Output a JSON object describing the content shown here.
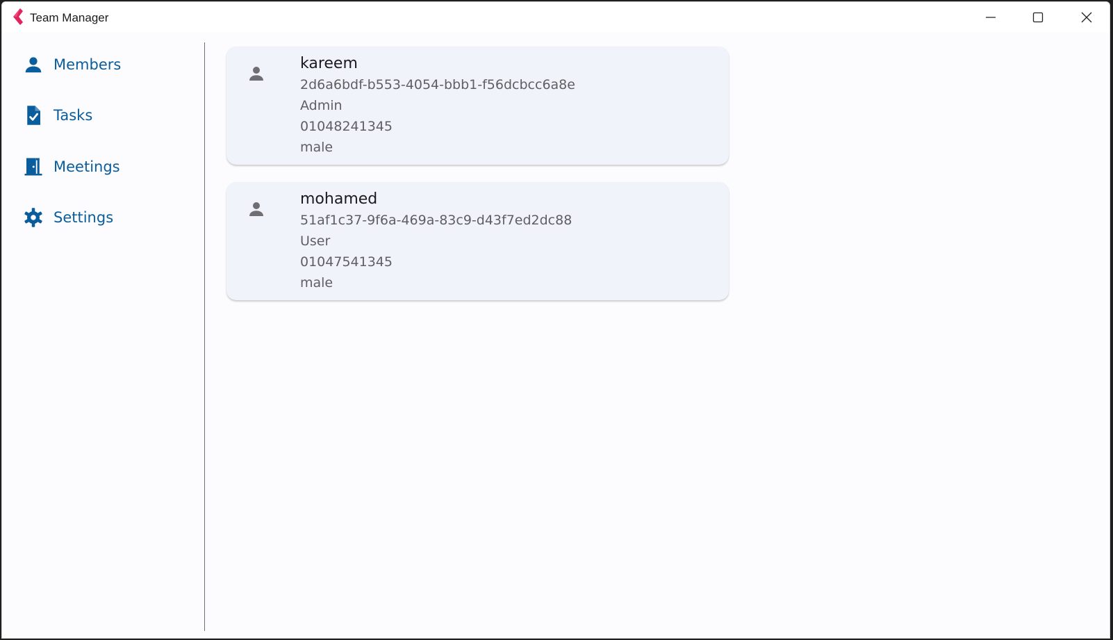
{
  "window": {
    "title": "Team Manager"
  },
  "sidebar": {
    "items": [
      {
        "label": "Members",
        "icon": "person-icon"
      },
      {
        "label": "Tasks",
        "icon": "task-document-icon"
      },
      {
        "label": "Meetings",
        "icon": "meeting-room-icon"
      },
      {
        "label": "Settings",
        "icon": "gear-icon"
      }
    ]
  },
  "members": [
    {
      "name": "kareem",
      "id": "2d6a6bdf-b553-4054-bbb1-f56dcbcc6a8e",
      "role": "Admin",
      "phone": "01048241345",
      "gender": "male"
    },
    {
      "name": "mohamed",
      "id": "51af1c37-9f6a-469a-83c9-d43f7ed2dc88",
      "role": "User",
      "phone": "01047541345",
      "gender": "male"
    }
  ],
  "colors": {
    "accent": "#0a5d9c",
    "card_background": "#f0f3fa",
    "page_background": "#fcfcff",
    "logo": "#e0245e"
  }
}
